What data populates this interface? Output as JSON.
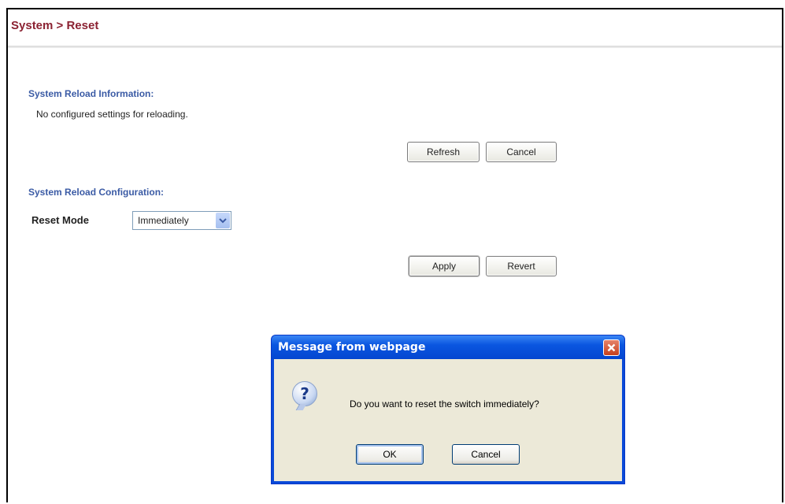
{
  "breadcrumb": "System > Reset",
  "reload_info": {
    "title": "System Reload Information:",
    "text": "No configured settings for reloading.",
    "refresh_label": "Refresh",
    "cancel_label": "Cancel"
  },
  "reload_config": {
    "title": "System Reload Configuration:",
    "reset_mode_label": "Reset Mode",
    "reset_mode_value": "Immediately",
    "apply_label": "Apply",
    "revert_label": "Revert"
  },
  "dialog": {
    "title": "Message from webpage",
    "message": "Do you want to reset the switch immediately?",
    "ok_label": "OK",
    "cancel_label": "Cancel",
    "icon": "question-icon"
  },
  "colors": {
    "breadcrumb": "#8b2232",
    "section_title": "#3b5ba5",
    "dialog_title_bar": "#0a56e0",
    "dialog_body": "#ece9d8"
  }
}
